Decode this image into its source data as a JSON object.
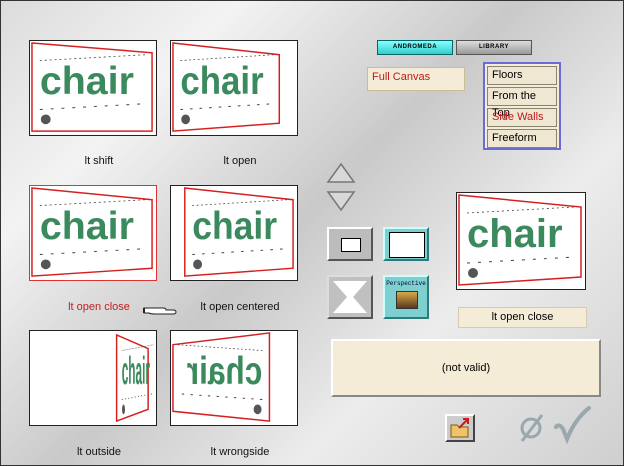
{
  "thumbnails": [
    {
      "caption": "lt shift",
      "variant": "shift",
      "selected": false
    },
    {
      "caption": "lt open",
      "variant": "open",
      "selected": false
    },
    {
      "caption": "lt open close",
      "variant": "openclose",
      "selected": true
    },
    {
      "caption": "lt open centered",
      "variant": "centered",
      "selected": false
    },
    {
      "caption": "lt outside",
      "variant": "outside",
      "selected": false
    },
    {
      "caption": "lt wrongside",
      "variant": "wrongside",
      "selected": false
    }
  ],
  "thumb_text": "chair",
  "tabs": {
    "andromeda": "ANDROMEDA",
    "library": "LIBRARY"
  },
  "category": {
    "selected": "Full Canvas"
  },
  "menu": {
    "items": [
      {
        "label": "Floors",
        "highlight": false
      },
      {
        "label": "From the Top",
        "highlight": false
      },
      {
        "label": "Side Walls",
        "highlight": true
      },
      {
        "label": "Freeform",
        "highlight": false
      }
    ]
  },
  "perspective_label": "Perspective",
  "preview": {
    "name": "lt open close",
    "variant": "openclose"
  },
  "status": {
    "text": "(not valid)"
  },
  "colors": {
    "accent_red": "#c01818",
    "menu_border": "#6a6ad8",
    "panel_bg": "#f4ecd6",
    "chair_green": "#3b8a5e"
  }
}
